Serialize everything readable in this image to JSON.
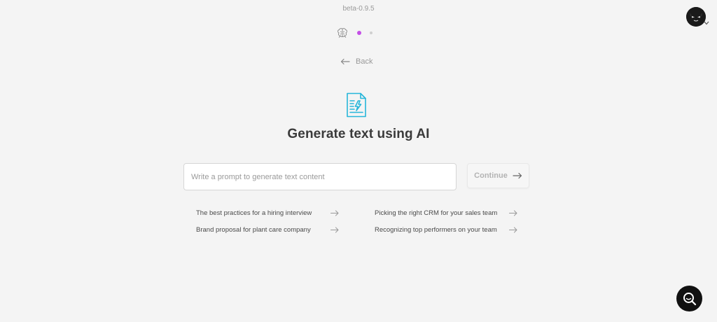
{
  "header": {
    "version": "beta-0.9.5"
  },
  "navigation": {
    "back_label": "Back"
  },
  "main": {
    "title": "Generate text using AI",
    "prompt_placeholder": "Write a prompt to generate text content",
    "continue_label": "Continue"
  },
  "suggestions": [
    "The best practices for a hiring interview",
    "Picking the right CRM for your sales team",
    "Brand proposal for plant care company",
    "Recognizing top performers on your team"
  ],
  "colors": {
    "accent_dot": "#c44ee6",
    "hero_icon": "#26b6d9",
    "background": "#f4f4f4"
  },
  "icons": {
    "steps": "brain-icon",
    "hero": "document-lightning-icon",
    "back": "arrow-left-icon",
    "continue": "arrow-right-icon",
    "chat": "search-chat-icon"
  }
}
